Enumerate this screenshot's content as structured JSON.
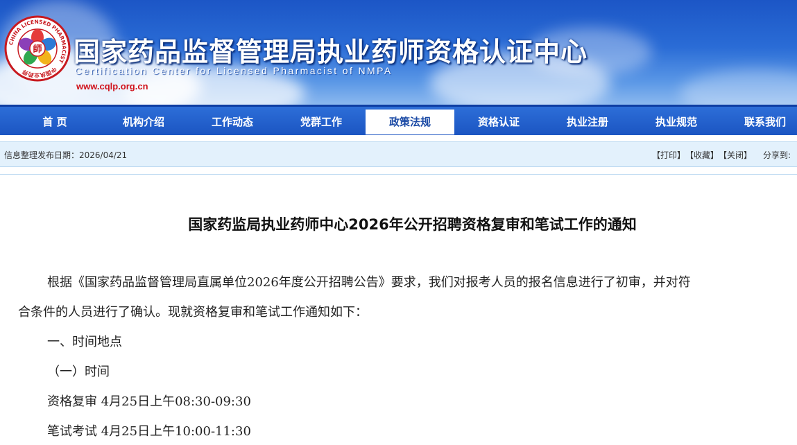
{
  "header": {
    "title": "国家药品监督管理局执业药师资格认证中心",
    "subtitle": "Certification Center for Licensed Pharmacist of NMPA",
    "url": "www.cqlp.org.cn",
    "logo": {
      "icon": "seal-logo-icon",
      "center_char": "師",
      "ring_text": "中国执业药师",
      "ring_text_en": "CHINA LICENSED PHARMACIST"
    }
  },
  "nav": {
    "items": [
      "首 页",
      "机构介绍",
      "工作动态",
      "党群工作",
      "政策法规",
      "资格认证",
      "执业注册",
      "执业规范",
      "联系我们"
    ],
    "active": "政策法规"
  },
  "info": {
    "publish_date": "信息整理发布日期：2026/04/21",
    "print": "【打印】",
    "favorite": "【收藏】",
    "close": "【关闭】",
    "share": "分享到:"
  },
  "article": {
    "title": "国家药监局执业药师中心2026年公开招聘资格复审和笔试工作的通知",
    "p1_line1": "根据《国家药品监督管理局直属单位2026年度公开招聘公告》要求，我们对报考人员的报名信息进行了初审，并对符",
    "p1_line2": "合条件的人员进行了确认。现就资格复审和笔试工作通知如下：",
    "section1": "一、时间地点",
    "sub1": "（一）时间",
    "item1": "资格复审 4月25日上午08:30-09:30",
    "item2": "笔试考试 4月25日上午10:00-11:30"
  },
  "colors": {
    "banner_blue": "#1c56c6",
    "nav_blue": "#1b55c2",
    "url_red": "#d0121b",
    "info_bg": "#e3f1fc"
  }
}
